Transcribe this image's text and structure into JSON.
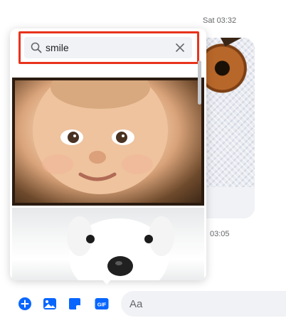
{
  "timestamps": {
    "top": "Sat 03:32",
    "middle": "03:05"
  },
  "gif_picker": {
    "search_value": "smile",
    "search_icon": "search-icon",
    "clear_icon": "close-icon",
    "results": [
      {
        "name": "baby-smile-gif"
      },
      {
        "name": "dog-gif"
      }
    ]
  },
  "composer": {
    "placeholder": "Aa",
    "buttons": [
      {
        "name": "add-button",
        "icon": "plus-circle-icon"
      },
      {
        "name": "photo-button",
        "icon": "image-icon"
      },
      {
        "name": "sticker-button",
        "icon": "sticker-icon"
      },
      {
        "name": "gif-button",
        "icon": "gif-icon",
        "label": "GIF"
      }
    ]
  },
  "colors": {
    "accent": "#0866ff",
    "highlight_border": "#e8331c",
    "input_bg": "#f0f2f5"
  }
}
